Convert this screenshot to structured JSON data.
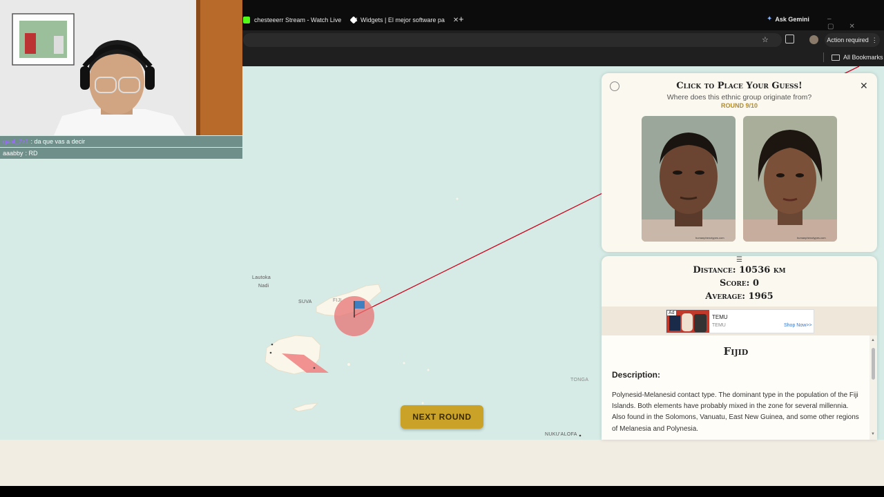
{
  "browser": {
    "tabs": [
      {
        "label": "chesteeerr Stream - Watch Live",
        "favicon_color": "#53fc18"
      },
      {
        "label": "Widgets | El mejor software pa",
        "favicon_color": "#ffffff"
      }
    ],
    "new_tab": "+",
    "ask_gemini": "Ask Gemini",
    "action_required": "Action required",
    "all_bookmarks": "All Bookmarks"
  },
  "stream": {
    "chat": [
      {
        "user": "gaal_7z1",
        "message": ": da que vas a decir"
      },
      {
        "user": "aaabby",
        "message": ": RD"
      }
    ]
  },
  "map": {
    "places": {
      "lautoka": "Lautoka",
      "nadi": "Nadi",
      "suva": "SUVA",
      "fiji": "FIJI",
      "tonga": "TONGA",
      "nukualofa": "NUKU'ALOFA"
    },
    "next_round": "NEXT ROUND",
    "line_color": "#d0021b"
  },
  "guess_panel": {
    "title": "Click to Place Your Guess!",
    "question": "Where does this ethnic group originate from?",
    "round": "ROUND 9/10",
    "watermark": "humanphenotypes.com"
  },
  "result_panel": {
    "handle": "☰",
    "distance": "Distance: 10536 km",
    "score": "Score: 0",
    "average": "Average: 1965",
    "ad": {
      "badge": "Ad",
      "brand": "TEMU",
      "sub": "TEMU",
      "cta": "Shop Now>>"
    },
    "group_name": "Fijid",
    "description_heading": "Description:",
    "description": "Polynesid-Melanesid contact type. The dominant type in the population of the Fiji Islands. Both elements have probably mixed in the zone for several millennia. Also found in the Solomons, Vanuatu, East New Guinea, and some other regions of Melanesia and Polynesia."
  }
}
